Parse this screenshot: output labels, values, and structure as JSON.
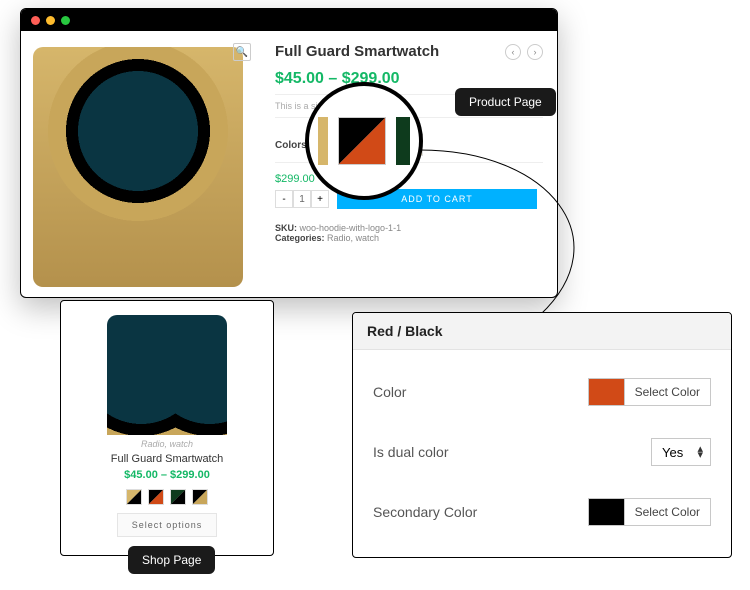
{
  "product_page": {
    "title": "Full Guard Smartwatch",
    "price_range": "$45.00 – $299.00",
    "description": "This is a simple pr",
    "colors_label": "Colors",
    "swatches": [
      {
        "name": "gold-black",
        "a": "#d6b66b",
        "b": "#000000",
        "selected": true
      },
      {
        "name": "red-black",
        "a": "#000000",
        "b": "#d14a17",
        "selected": false
      },
      {
        "name": "green-black",
        "a": "#0e3b1d",
        "b": "#000000",
        "selected": false
      },
      {
        "name": "black-gold",
        "a": "#000000",
        "b": "#c8a65a",
        "selected": false
      }
    ],
    "variant_price": "$299.00",
    "qty": "1",
    "add_to_cart": "ADD TO CART",
    "sku_label": "SKU:",
    "sku_value": "woo-hoodie-with-logo-1-1",
    "categories_label": "Categories:",
    "categories_value": "Radio, watch"
  },
  "magnifier": {
    "swatches": [
      {
        "a": "#000000",
        "b": "#d14a17"
      }
    ]
  },
  "shop_card": {
    "category": "Radio, watch",
    "title": "Full Guard Smartwatch",
    "price_range": "$45.00 – $299.00",
    "swatches": [
      {
        "a": "#d6b66b",
        "b": "#000000"
      },
      {
        "a": "#000000",
        "b": "#d14a17"
      },
      {
        "a": "#0e3b1d",
        "b": "#000000"
      },
      {
        "a": "#000000",
        "b": "#c8a65a"
      }
    ],
    "button_label": "Select options"
  },
  "settings_panel": {
    "header": "Red / Black",
    "rows": {
      "color": {
        "label": "Color",
        "chip": "#d14a17",
        "button": "Select Color"
      },
      "is_dual": {
        "label": "Is dual color",
        "value": "Yes"
      },
      "secondary_color": {
        "label": "Secondary Color",
        "chip": "#000000",
        "button": "Select Color"
      }
    }
  },
  "callouts": {
    "product_page": "Product Page",
    "shop_page": "Shop Page"
  }
}
